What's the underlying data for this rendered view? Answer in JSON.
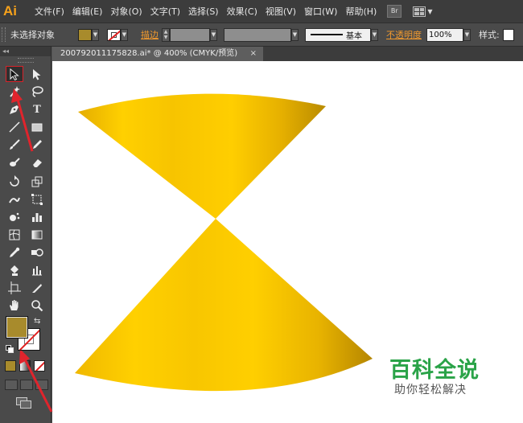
{
  "app": {
    "logo": "Ai"
  },
  "menu": {
    "items": [
      "文件(F)",
      "编辑(E)",
      "对象(O)",
      "文字(T)",
      "选择(S)",
      "效果(C)",
      "视图(V)",
      "窗口(W)",
      "帮助(H)"
    ],
    "bridge_label": "Br"
  },
  "control": {
    "selection": "未选择对象",
    "stroke_label": "描边",
    "stroke_style": "基本",
    "opacity_label": "不透明度",
    "opacity_value": "100%",
    "style_label": "样式"
  },
  "panel": {
    "collapse": "◂◂"
  },
  "document": {
    "tab_title": "200792011175828.ai* @ 400% (CMYK/预览)",
    "close": "×"
  },
  "colors": {
    "fill": "#a88b2c",
    "gold_light": "#ffcf00",
    "gold_mid": "#f3bd00",
    "gold_dark": "#b88a00",
    "annotation_red": "#e0242c"
  },
  "watermark": {
    "title": "百科全说",
    "subtitle": "助你轻松解决"
  },
  "icons": [
    "selection-icon",
    "direct-selection-icon",
    "magic-wand-icon",
    "lasso-icon",
    "pen-icon",
    "type-icon",
    "line-icon",
    "rectangle-icon",
    "paintbrush-icon",
    "pencil-icon",
    "blob-brush-icon",
    "eraser-icon",
    "rotate-icon",
    "scale-icon",
    "warp-icon",
    "free-transform-icon",
    "symbol-sprayer-icon",
    "column-graph-icon",
    "mesh-icon",
    "gradient-icon",
    "eyedropper-icon",
    "blend-icon",
    "live-paint-icon",
    "artboard-icon",
    "slice-icon",
    "hand-icon",
    "zoom-icon"
  ]
}
